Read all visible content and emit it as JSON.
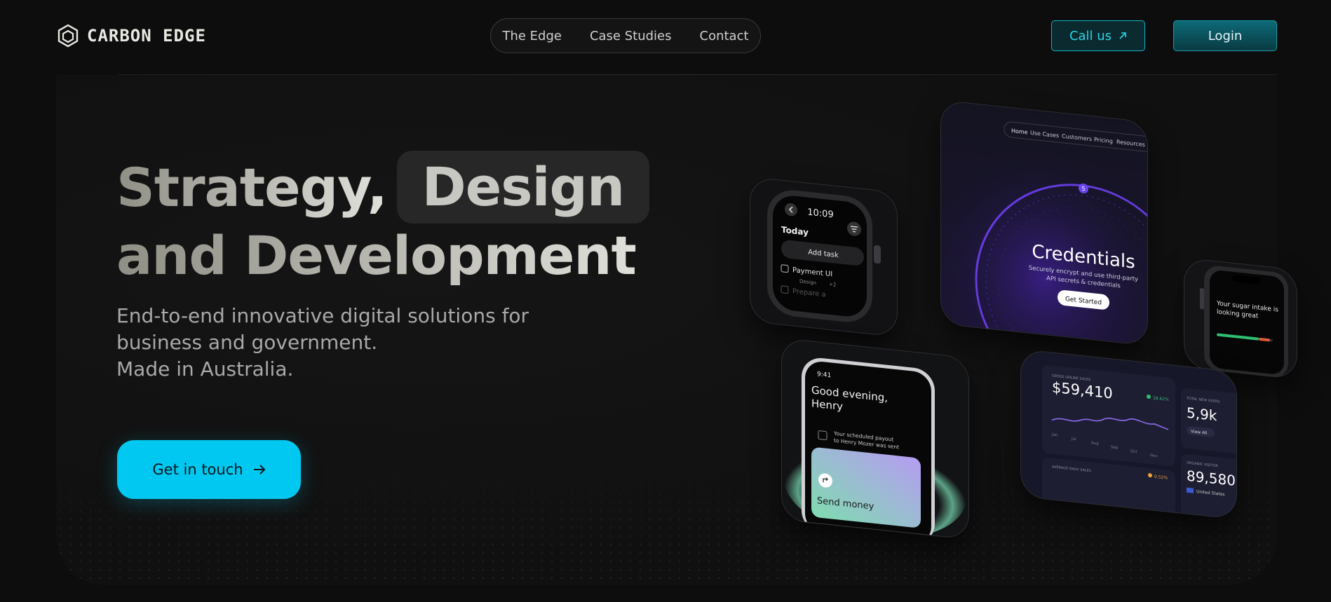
{
  "header": {
    "brand": "CARBON EDGE",
    "nav": [
      "The Edge",
      "Case Studies",
      "Contact"
    ],
    "call_label": "Call us",
    "login_label": "Login"
  },
  "hero": {
    "headline_part1": "Strategy,",
    "headline_highlight": "Design",
    "headline_line2": "and Development",
    "sub_line1": "End-to-end innovative digital solutions for",
    "sub_line2": "business and government.",
    "sub_line3": "Made in Australia.",
    "cta_label": "Get in touch"
  },
  "cards": {
    "watch": {
      "time": "10:09",
      "title": "Today",
      "add_task": "Add task",
      "task1": "Payment UI",
      "task1_meta": "Design",
      "task1_count": "+2",
      "task2": "Prepare a"
    },
    "credentials": {
      "nav": [
        "Home",
        "Use Cases",
        "Customers",
        "Pricing",
        "Resources"
      ],
      "title": "Credentials",
      "desc_line1": "Securely encrypt and use third-party",
      "desc_line2": "API secrets & credentials",
      "button": "Get Started"
    },
    "phone_right": {
      "message_line1": "Your sugar intake is",
      "message_line2": "looking great"
    },
    "phone": {
      "time": "9:41",
      "greeting_line1": "Good evening,",
      "greeting_line2": "Henry",
      "notice_line1": "Your scheduled payout",
      "notice_line2": "to Henry Mozer was sent",
      "send_label": "Send money"
    },
    "dashboard": {
      "sales_label": "GROSS ONLINE SALES",
      "sales_value": "$59,410",
      "sales_change": "18.62%",
      "months": [
        "Jan",
        "Jul",
        "Aug",
        "Sep",
        "Oct",
        "Nov"
      ],
      "new_users_label": "TOTAL NEW USERS",
      "new_users_value": "5,9k",
      "view_all": "View All",
      "avg_label": "AVERAGE DAILY SALES",
      "avg_change": "0.52%",
      "visitors_label": "ORGANIC VISITOR",
      "visitors_value": "89,580",
      "country": "United States"
    }
  }
}
